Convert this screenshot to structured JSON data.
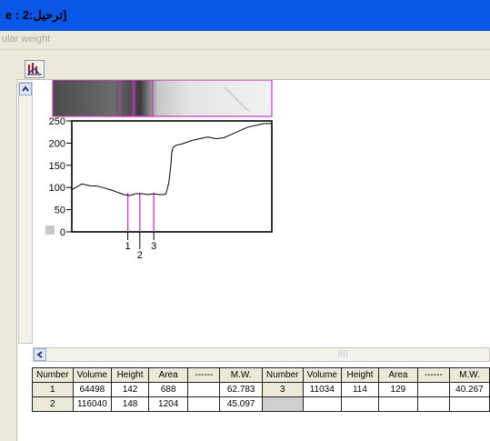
{
  "window": {
    "title": "e : 2:ترحيل]"
  },
  "subtitle": "ular weight",
  "icons": {
    "toolbar": "histogram-icon",
    "scroll_up": "scroll-up-arrow-icon",
    "scroll_left": "scroll-left-arrow-icon"
  },
  "lane": {
    "label": "3"
  },
  "chart_data": {
    "type": "line",
    "y_ticks": [
      "250",
      "200",
      "150",
      "100",
      "50",
      "0"
    ],
    "ylim": [
      0,
      250
    ],
    "x_range": [
      0,
      100
    ],
    "profile": {
      "x": [
        0,
        2,
        5,
        9,
        13,
        17,
        20,
        23,
        26,
        29,
        32,
        35,
        38,
        41,
        43.5,
        44.5,
        45.5,
        47,
        48.5,
        49.5,
        50,
        50.6,
        52,
        55,
        60,
        64,
        68,
        72,
        76,
        80,
        84,
        88,
        92,
        96,
        100
      ],
      "y": [
        95,
        100,
        108,
        104,
        103,
        98,
        94,
        89,
        84,
        82,
        86,
        86,
        84,
        86,
        84,
        84,
        84,
        85,
        110,
        150,
        180,
        190,
        195,
        198,
        206,
        210,
        214,
        210,
        212,
        220,
        228,
        236,
        240,
        244,
        244
      ]
    },
    "bands": [
      {
        "label": "1",
        "x": 28
      },
      {
        "label": "2",
        "x": 34
      },
      {
        "label": "3",
        "x": 41
      }
    ]
  },
  "table": {
    "headers": [
      "Number",
      "Volume",
      "Height",
      "Area",
      "------",
      "M.W.",
      "Number",
      "Volume",
      "Height",
      "Area",
      "------",
      "M.W."
    ],
    "rows": [
      [
        "1",
        "64498",
        "142",
        "688",
        "",
        "62.783",
        "3",
        "11034",
        "114",
        "129",
        "",
        "40.267"
      ],
      [
        "2",
        "116040",
        "148",
        "1204",
        "",
        "45.097",
        "",
        "",
        "",
        "",
        "",
        ""
      ]
    ]
  },
  "colors": {
    "titlebar": "#0a56e6",
    "band_line": "#cc33cc",
    "chrome": "#ece9d8"
  }
}
